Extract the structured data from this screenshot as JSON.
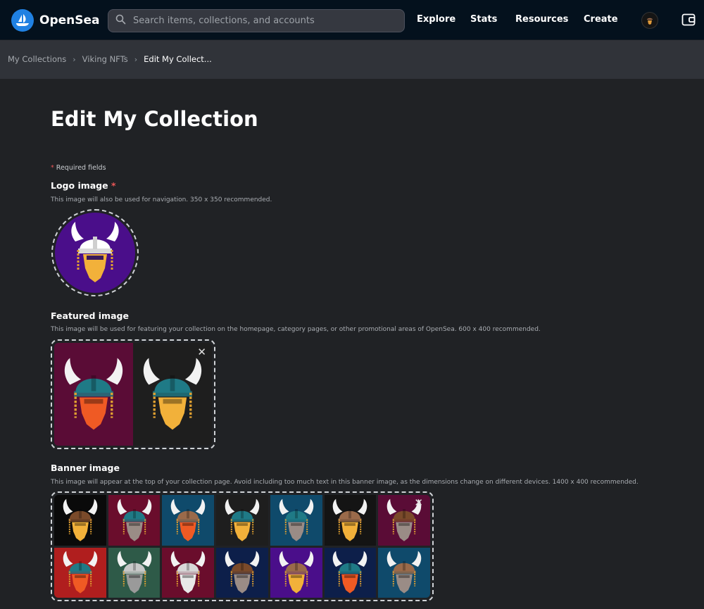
{
  "brand": {
    "name": "OpenSea"
  },
  "search": {
    "placeholder": "Search items, collections, and accounts"
  },
  "nav": {
    "explore": "Explore",
    "stats": "Stats",
    "resources": "Resources",
    "create": "Create"
  },
  "breadcrumb": {
    "items": [
      "My Collections",
      "Viking NFTs",
      "Edit My Collect..."
    ]
  },
  "page": {
    "title": "Edit My Collection",
    "required_note": "Required fields"
  },
  "fields": {
    "logo": {
      "label": "Logo image",
      "description": "This image will also be used for navigation. 350 x 350 recommended."
    },
    "featured": {
      "label": "Featured image",
      "description": "This image will be used for featuring your collection on the homepage, category pages, or other promotional areas of OpenSea. 600 x 400 recommended."
    },
    "banner": {
      "label": "Banner image",
      "description": "This image will appear at the top of your collection page. Avoid including too much text in this banner image, as the dimensions change on different devices. 1400 x 400 recommended."
    }
  },
  "colors": {
    "accent": "#2081e2",
    "required": "#eb5757",
    "logo_bg": "#4a0e8a",
    "featured_tiles": [
      {
        "bg": "#5a0c36",
        "helmet": "#1f7a86",
        "beard": "#ef5a24"
      },
      {
        "bg": "#1e1e1e",
        "helmet": "#1f7a86",
        "beard": "#f2b13a"
      }
    ],
    "banner_tiles": [
      {
        "bg": "#0a0a0a",
        "helmet": "#7a4a2a",
        "beard": "#f2b13a"
      },
      {
        "bg": "#6a0d2c",
        "helmet": "#1f7a86",
        "beard": "#9a8c86"
      },
      {
        "bg": "#0f4a6b",
        "helmet": "#9a6a4a",
        "beard": "#ef5a24"
      },
      {
        "bg": "#1e1e1e",
        "helmet": "#1f7a86",
        "beard": "#f2b13a"
      },
      {
        "bg": "#0f4a6b",
        "helmet": "#1f7a86",
        "beard": "#9a8c86"
      },
      {
        "bg": "#141414",
        "helmet": "#9a6a4a",
        "beard": "#f2b13a"
      },
      {
        "bg": "#5a0c36",
        "helmet": "#7a4a2a",
        "beard": "#9a8c86"
      },
      {
        "bg": "#b01e1e",
        "helmet": "#1f7a86",
        "beard": "#ef5a24"
      },
      {
        "bg": "#2e5a48",
        "helmet": "#c8c8c8",
        "beard": "#9a9a9a"
      },
      {
        "bg": "#6a0d2c",
        "helmet": "#d8d8d8",
        "beard": "#e8e8e8"
      },
      {
        "bg": "#0d1f4a",
        "helmet": "#7a4a2a",
        "beard": "#9a8c86"
      },
      {
        "bg": "#4a0e8a",
        "helmet": "#9a6a4a",
        "beard": "#f2b13a"
      },
      {
        "bg": "#0d1f4a",
        "helmet": "#1f7a86",
        "beard": "#ef5a24"
      },
      {
        "bg": "#0f4a6b",
        "helmet": "#9a6a4a",
        "beard": "#9a8c86"
      }
    ]
  },
  "icons": {
    "brand": "opensea-logo-icon",
    "search": "search-icon",
    "avatar": "viking-avatar-icon",
    "wallet": "wallet-icon",
    "remove": "close-icon",
    "breadcrumb_sep": "chevron-right-icon"
  }
}
